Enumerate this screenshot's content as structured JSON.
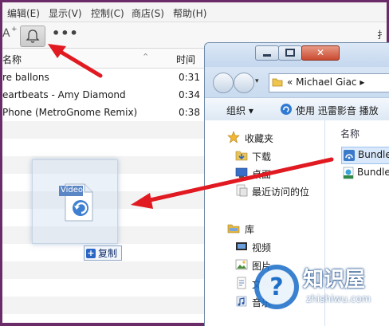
{
  "menubar": {
    "items": [
      "编辑(E)",
      "显示(V)",
      "控制(C)",
      "商店(S)",
      "帮助(H)"
    ]
  },
  "toolbar": {
    "glyph_left": "A",
    "bell_icon": "bell-icon",
    "more": "•••",
    "right_glyph": "扌"
  },
  "songlist": {
    "col_name": "名称",
    "col_time": "时间",
    "rows": [
      {
        "name": "re ballons",
        "time": "0:31"
      },
      {
        "name": "eartbeats - Amy Diamond",
        "time": "0:34"
      },
      {
        "name": "Phone (MetroGnome Remix)",
        "time": "0:38"
      }
    ]
  },
  "drag": {
    "file_label": "Video",
    "copy_label": "复制"
  },
  "explorer": {
    "address_prefix": "«",
    "address": "Michael Giac",
    "address_suffix": "▸",
    "cmd_organize": "组织 ▾",
    "cmd_play": "使用 迅雷影音 播放",
    "nav": [
      {
        "label": "收藏夹",
        "icon": "star-icon"
      },
      {
        "label": "下载",
        "icon": "download-folder-icon"
      },
      {
        "label": "桌面",
        "icon": "desktop-icon"
      },
      {
        "label": "最近访问的位",
        "icon": "recent-places-icon"
      },
      {
        "label": "库",
        "icon": "library-icon"
      },
      {
        "label": "视频",
        "icon": "video-library-icon"
      },
      {
        "label": "图片",
        "icon": "pictures-library-icon"
      },
      {
        "label": "文档",
        "icon": "documents-library-icon"
      },
      {
        "label": "音乐",
        "icon": "music-library-icon"
      }
    ],
    "files_header": "名称",
    "files": [
      {
        "label": "Bundle",
        "icon": "ringtone-file-icon"
      },
      {
        "label": "Bundle",
        "icon": "mp3-file-icon"
      }
    ]
  },
  "watermark": {
    "title": "知识屋",
    "url": "zhishiwu.com"
  },
  "colors": {
    "arrow": "#e11a22",
    "frame": "#6b2a68",
    "selection": "#d9e9fb"
  }
}
